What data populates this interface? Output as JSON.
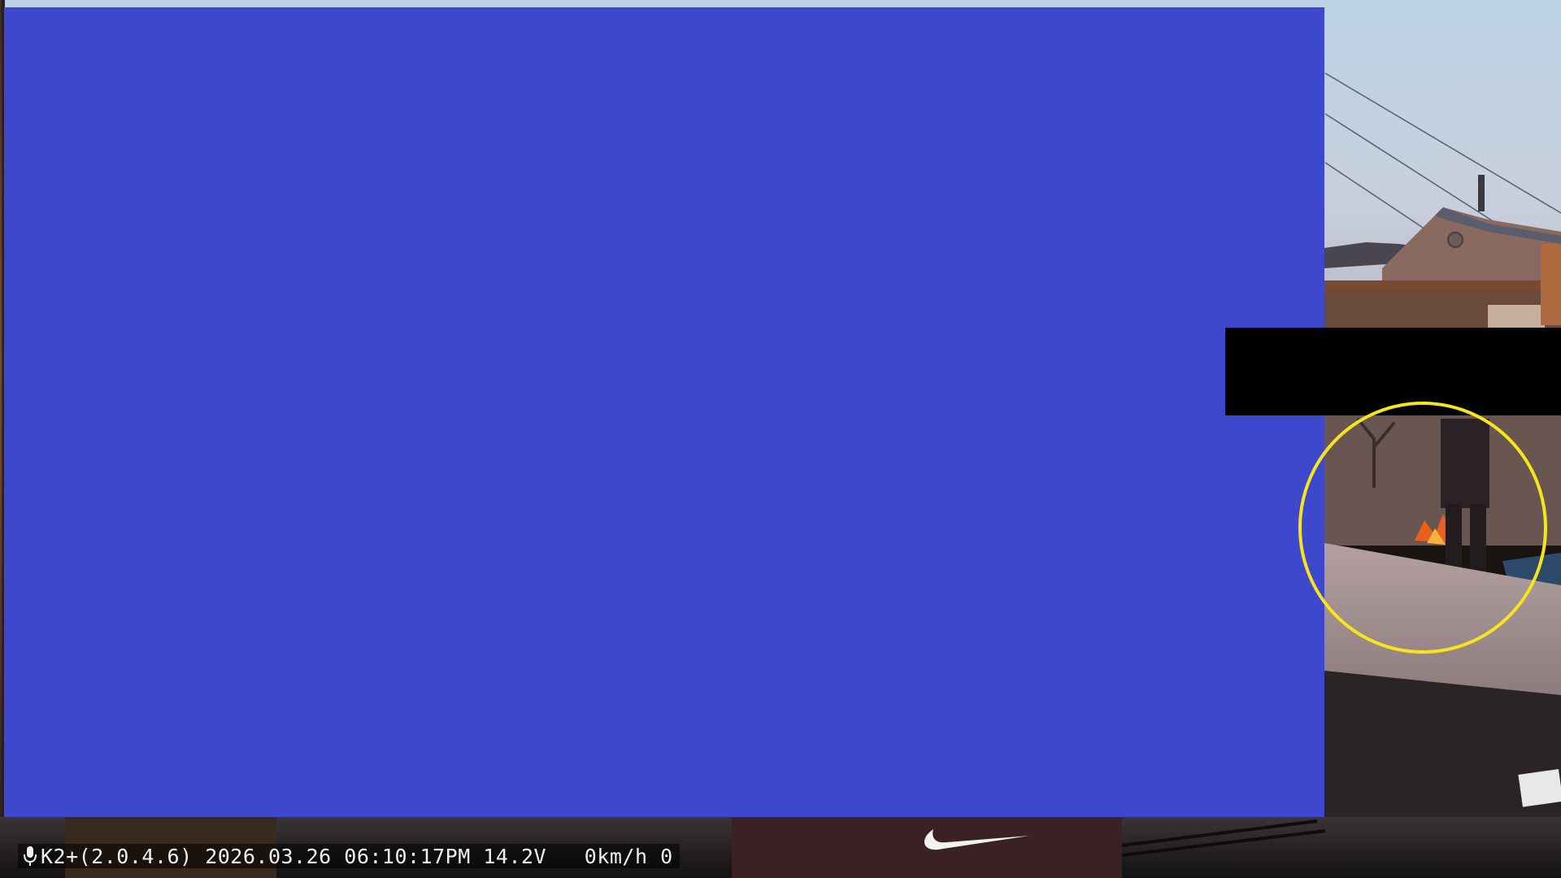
{
  "overlay": {
    "blue_color": "#3d48cc",
    "black_color": "#000000"
  },
  "annotation": {
    "circle_color": "#f5e51a"
  },
  "hud": {
    "mic_icon": "microphone-icon",
    "model": "K2+(2.0.4.6)",
    "date": "2026.03.26",
    "time": "06:10:17PM",
    "voltage": "14.2V",
    "speed": "0km/h 0"
  }
}
